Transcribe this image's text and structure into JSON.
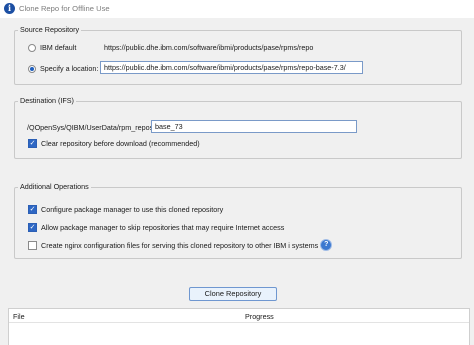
{
  "window": {
    "title": "Clone Repo for Offline Use",
    "icon": "ibm-i-app-icon"
  },
  "source_repository": {
    "legend": "Source Repository",
    "ibm_default": {
      "label": "IBM default",
      "url": "https://public.dhe.ibm.com/software/ibmi/products/pase/rpms/repo",
      "selected": false
    },
    "specify_location": {
      "label": "Specify a location:",
      "value": "https://public.dhe.ibm.com/software/ibmi/products/pase/rpms/repo-base-7.3/",
      "selected": true
    }
  },
  "destination": {
    "legend": "Destination (IFS)",
    "path_prefix": "/QOpenSys/QIBM/UserData/rpm_repos/",
    "folder_value": "base_73",
    "clear_repo": {
      "label": "Clear repository before download (recommended)",
      "checked": true
    }
  },
  "additional_operations": {
    "legend": "Additional Operations",
    "configure_pkg_mgr": {
      "label": "Configure package manager to use this cloned repository",
      "checked": true
    },
    "allow_skip": {
      "label": "Allow package manager to skip repositories that may require Internet access",
      "checked": true
    },
    "nginx_config": {
      "label": "Create nginx configuration files for serving this cloned repository to other IBM i systems",
      "checked": false
    },
    "help_icon": "question-help-icon"
  },
  "actions": {
    "clone_label": "Clone Repository"
  },
  "progress_table": {
    "columns": [
      "File",
      "Progress"
    ],
    "rows": []
  },
  "colors": {
    "accent": "#2e67c4",
    "button_bg": "#e9f2fc",
    "window_bg": "#f0f0f0"
  }
}
